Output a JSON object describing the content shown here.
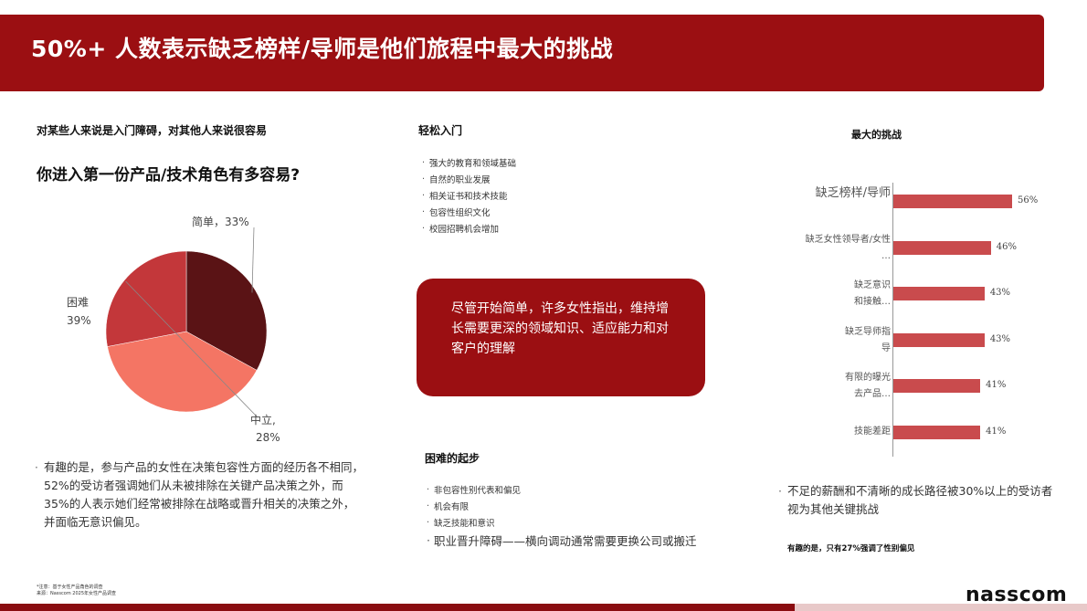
{
  "header": {
    "title": "50%+ 人数表示缺乏榜样/导师是他们旅程中最大的挑战"
  },
  "left": {
    "subtitle": "对某些人来说是入门障碍，对其他人来说很容易",
    "question": "你进入第一份产品/技术角色有多容易?",
    "pie_labels": {
      "easy_name": "简单，33%",
      "hard_name": "困难",
      "hard_pct": "39%",
      "neutral_name": "中立,",
      "neutral_pct": "28%"
    },
    "note": "有趣的是，参与产品的女性在决策包容性方面的经历各不相同，52%的受访者强调她们从未被排除在关键产品决策之外，而35%的人表示她们经常被排除在战略或晋升相关的决策之外，并面临无意识偏见。",
    "footnote_1": "*注意：基于女性产品角色的调查",
    "footnote_2": "来源：Nasscom 2025年女性产品调查"
  },
  "chart_data": [
    {
      "type": "pie",
      "categories": [
        "简单",
        "困难",
        "中立"
      ],
      "values": [
        33,
        39,
        28
      ],
      "colors": [
        "#5a1315",
        "#f47564",
        "#c3373a"
      ]
    },
    {
      "type": "bar",
      "title": "最大的挑战",
      "categories": [
        "缺乏榜样/导师",
        "缺乏女性领导者/女性…",
        "缺乏意识和接触…",
        "缺乏导师指导",
        "有限的曝光去产品…",
        "技能差距"
      ],
      "values": [
        56,
        46,
        43,
        43,
        41,
        41
      ],
      "value_labels": [
        "56%",
        "46%",
        "43%",
        "43%",
        "41%",
        "41%"
      ],
      "color": "#c94b4d"
    }
  ],
  "middle": {
    "easy_heading": "轻松入门",
    "easy_items": [
      "强大的教育和领域基础",
      "自然的职业发展",
      "相关证书和技术技能",
      "包容性组织文化",
      "校园招聘机会增加"
    ],
    "callout": "尽管开始简单，许多女性指出，维持增长需要更深的领域知识、适应能力和对客户的理解",
    "hard_heading": "困难的起步",
    "hard_items": [
      "非包容性别代表和偏见",
      "机会有限",
      "缺乏技能和意识"
    ],
    "hard_item_big": "职业晋升障碍——横向调动通常需要更换公司或搬迁"
  },
  "right": {
    "bar_labels": [
      [
        "缺乏榜样/导师"
      ],
      [
        "缺乏女性领导者/女性",
        "…"
      ],
      [
        "缺乏意识",
        "和接触…"
      ],
      [
        "缺乏导师指",
        "导"
      ],
      [
        "有限的曝光",
        "去产品…"
      ],
      [
        "技能差距"
      ]
    ],
    "note": "不足的薪酬和不清晰的成长路径被30%以上的受访者视为其他关键挑战",
    "small_note": "有趣的是，只有27%强调了性别偏见"
  },
  "brand": {
    "logo": "nasscom",
    "primary": "#9b0f12"
  }
}
